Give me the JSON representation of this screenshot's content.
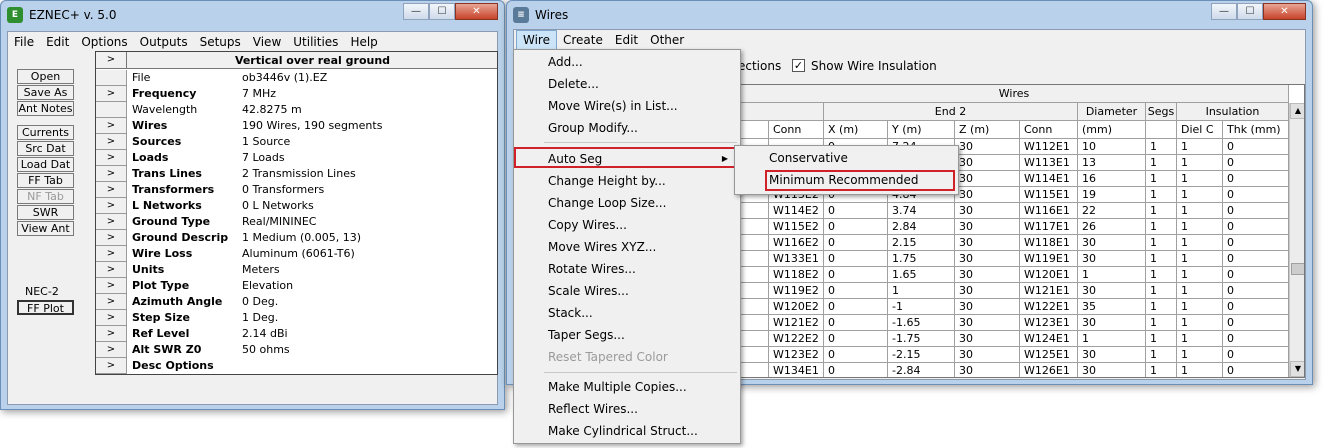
{
  "eznec": {
    "title": "EZNEC+  v. 5.0",
    "menu": [
      "File",
      "Edit",
      "Options",
      "Outputs",
      "Setups",
      "View",
      "Utilities",
      "Help"
    ],
    "buttons_top": [
      "Open",
      "Save As",
      "Ant Notes"
    ],
    "buttons_mid": [
      "Currents",
      "Src Dat",
      "Load Dat",
      "FF Tab",
      "NF Tab",
      "SWR",
      "View Ant"
    ],
    "engine_label": "NEC-2",
    "plot_button": "FF Plot",
    "table_title": "Vertical over real ground",
    "rows": [
      {
        "label": "File",
        "bold": false,
        "value": "ob3446v (1).EZ",
        "arrow": false
      },
      {
        "label": "Frequency",
        "bold": true,
        "value": "7 MHz",
        "arrow": true
      },
      {
        "label": "Wavelength",
        "bold": false,
        "value": "42.8275 m",
        "arrow": false
      },
      {
        "label": "Wires",
        "bold": true,
        "value": "190 Wires, 190 segments",
        "arrow": true
      },
      {
        "label": "Sources",
        "bold": true,
        "value": "1 Source",
        "arrow": true
      },
      {
        "label": "Loads",
        "bold": true,
        "value": "7 Loads",
        "arrow": true
      },
      {
        "label": "Trans Lines",
        "bold": true,
        "value": "2 Transmission Lines",
        "arrow": true
      },
      {
        "label": "Transformers",
        "bold": true,
        "value": "0 Transformers",
        "arrow": true
      },
      {
        "label": "L Networks",
        "bold": true,
        "value": "0 L Networks",
        "arrow": true
      },
      {
        "label": "Ground Type",
        "bold": true,
        "value": "Real/MININEC",
        "arrow": true
      },
      {
        "label": "Ground Descrip",
        "bold": true,
        "value": "1 Medium (0.005, 13)",
        "arrow": true
      },
      {
        "label": "Wire Loss",
        "bold": true,
        "value": "Aluminum (6061-T6)",
        "arrow": true
      },
      {
        "label": "Units",
        "bold": true,
        "value": "Meters",
        "arrow": true
      },
      {
        "label": "Plot Type",
        "bold": true,
        "value": "Elevation",
        "arrow": true
      },
      {
        "label": "Azimuth Angle",
        "bold": true,
        "value": "0 Deg.",
        "arrow": true
      },
      {
        "label": "Step Size",
        "bold": true,
        "value": "1 Deg.",
        "arrow": true
      },
      {
        "label": "Ref Level",
        "bold": true,
        "value": "2.14 dBi",
        "arrow": true
      },
      {
        "label": "Alt SWR Z0",
        "bold": true,
        "value": "50 ohms",
        "arrow": true
      },
      {
        "label": "Desc Options",
        "bold": true,
        "value": "",
        "arrow": true
      }
    ]
  },
  "wires_window": {
    "title": "Wires",
    "menu": [
      "Wire",
      "Create",
      "Edit",
      "Other"
    ],
    "option_partial": "ections",
    "show_insulation_label": "Show Wire Insulation",
    "show_insulation_checked": "✓",
    "group_header": "Wires",
    "end2_header": "End 2",
    "diameter_header": "Diameter",
    "segs_header": "Segs",
    "insulation_header": "Insulation",
    "sub_headers": [
      "Conn",
      "X (m)",
      "Y (m)",
      "Z (m)",
      "Conn",
      "(mm)",
      "",
      "Diel C",
      "Thk (mm)"
    ],
    "rows": [
      [
        "",
        "0",
        "7.24",
        "30",
        "W112E1",
        "10",
        "1",
        "1",
        "0"
      ],
      [
        "",
        "0",
        "",
        "30",
        "W113E1",
        "13",
        "1",
        "1",
        "0"
      ],
      [
        "",
        "0",
        "",
        "30",
        "W114E1",
        "16",
        "1",
        "1",
        "0"
      ],
      [
        "W113E2",
        "0",
        "4.84",
        "30",
        "W115E1",
        "19",
        "1",
        "1",
        "0"
      ],
      [
        "W114E2",
        "0",
        "3.74",
        "30",
        "W116E1",
        "22",
        "1",
        "1",
        "0"
      ],
      [
        "W115E2",
        "0",
        "2.84",
        "30",
        "W117E1",
        "26",
        "1",
        "1",
        "0"
      ],
      [
        "W116E2",
        "0",
        "2.15",
        "30",
        "W118E1",
        "30",
        "1",
        "1",
        "0"
      ],
      [
        "W133E1",
        "0",
        "1.75",
        "30",
        "W119E1",
        "30",
        "1",
        "1",
        "0"
      ],
      [
        "W118E2",
        "0",
        "1.65",
        "30",
        "W120E1",
        "1",
        "1",
        "1",
        "0"
      ],
      [
        "W119E2",
        "0",
        "1",
        "30",
        "W121E1",
        "30",
        "1",
        "1",
        "0"
      ],
      [
        "W120E2",
        "0",
        "-1",
        "30",
        "W122E1",
        "35",
        "1",
        "1",
        "0"
      ],
      [
        "W121E2",
        "0",
        "-1.65",
        "30",
        "W123E1",
        "30",
        "1",
        "1",
        "0"
      ],
      [
        "W122E2",
        "0",
        "-1.75",
        "30",
        "W124E1",
        "1",
        "1",
        "1",
        "0"
      ],
      [
        "W123E2",
        "0",
        "-2.15",
        "30",
        "W125E1",
        "30",
        "1",
        "1",
        "0"
      ],
      [
        "W134E1",
        "0",
        "-2.84",
        "30",
        "W126E1",
        "30",
        "1",
        "1",
        "0"
      ]
    ]
  },
  "wire_menu": {
    "items": [
      {
        "label": "Add...",
        "disabled": false
      },
      {
        "label": "Delete...",
        "disabled": false
      },
      {
        "label": "Move Wire(s) in List...",
        "disabled": false
      },
      {
        "label": "Group Modify...",
        "disabled": false
      },
      {
        "label": "Auto Seg",
        "disabled": false,
        "submenu": true
      },
      {
        "label": "Change Height by...",
        "disabled": false
      },
      {
        "label": "Change Loop Size...",
        "disabled": false
      },
      {
        "label": "Copy Wires...",
        "disabled": false
      },
      {
        "label": "Move Wires XYZ...",
        "disabled": false
      },
      {
        "label": "Rotate Wires...",
        "disabled": false
      },
      {
        "label": "Scale Wires...",
        "disabled": false
      },
      {
        "label": "Stack...",
        "disabled": false
      },
      {
        "label": "Taper Segs...",
        "disabled": false
      },
      {
        "label": "Reset Tapered Color",
        "disabled": true
      },
      {
        "label": "Make Multiple Copies...",
        "disabled": false
      },
      {
        "label": "Reflect Wires...",
        "disabled": false
      },
      {
        "label": "Make Cylindrical Struct...",
        "disabled": false
      }
    ],
    "submenu_arrow": "▶"
  },
  "autoseg_submenu": {
    "items": [
      "Conservative",
      "Minimum Recommended"
    ]
  },
  "colors": {
    "highlight": "#d0202a",
    "menu_active": "#cce4f7"
  }
}
